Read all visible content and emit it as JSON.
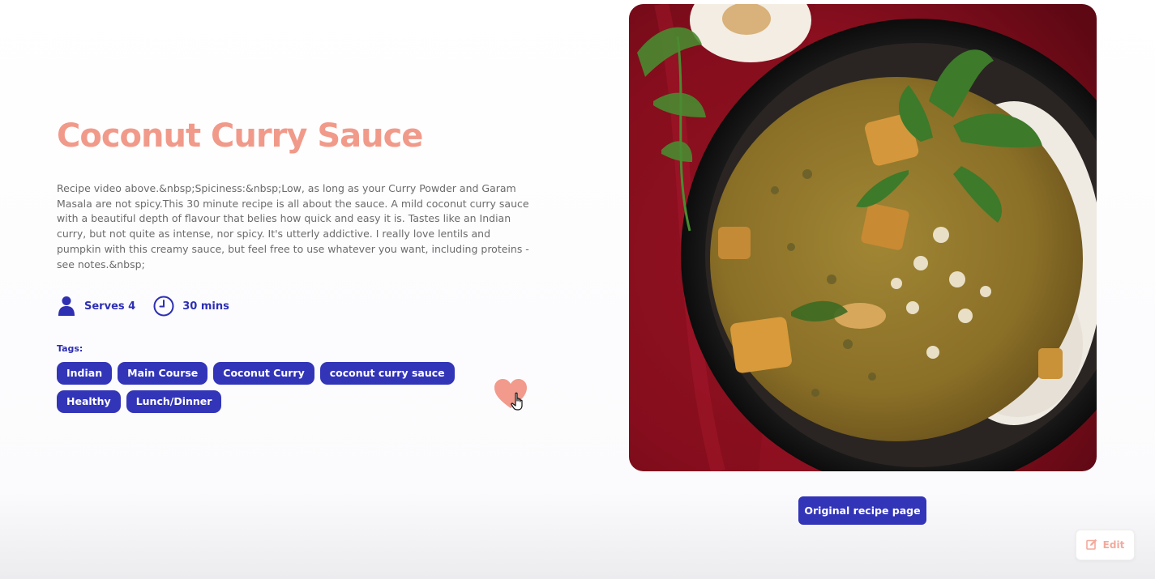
{
  "recipe": {
    "title": "Coconut Curry Sauce",
    "description": "Recipe video above.&nbsp;Spiciness:&nbsp;Low, as long as your Curry Powder and Garam Masala are not spicy.This 30 minute recipe is all about the sauce. A mild coconut curry sauce with a beautiful depth of flavour that belies how quick and easy it is. Tastes like an Indian curry, but not quite as intense, nor spicy. It's utterly addictive. I really love lentils and pumpkin with this creamy sauce, but feel free to use whatever you want, including proteins - see notes.&nbsp;",
    "serves": "Serves 4",
    "time": "30 mins",
    "tags_label": "Tags:",
    "tags": [
      "Indian",
      "Main Course",
      "Coconut Curry",
      "coconut curry sauce",
      "Healthy",
      "Lunch/Dinner"
    ],
    "favorite_icon": "heart-icon",
    "image_alt": "curry-bowl-photo"
  },
  "actions": {
    "original_recipe": "Original recipe page",
    "edit": "Edit"
  },
  "icons": {
    "serves": "person-icon",
    "time": "clock-icon",
    "edit": "edit-icon"
  },
  "colors": {
    "title": "#f19a8a",
    "accent": "#3335b8",
    "heart": "#f29a8c",
    "edit_text": "#f3a99c"
  }
}
